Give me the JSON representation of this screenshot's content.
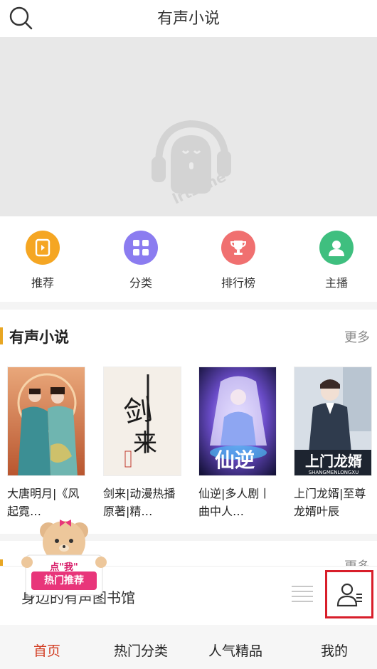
{
  "header": {
    "title": "有声小说",
    "search_icon": "search-icon"
  },
  "banner": {
    "logo_text": "lrts.me"
  },
  "quick_nav": [
    {
      "label": "推荐",
      "icon": "book-icon",
      "color": "#f5a623"
    },
    {
      "label": "分类",
      "icon": "grid-icon",
      "color": "#8b7cf0"
    },
    {
      "label": "排行榜",
      "icon": "trophy-icon",
      "color": "#f07070"
    },
    {
      "label": "主播",
      "icon": "anchor-icon",
      "color": "#3fbf7f"
    }
  ],
  "section": {
    "title": "有声小说",
    "more": "更多",
    "books": [
      {
        "title": "大唐明月|《风起霓…"
      },
      {
        "title": "剑来|动漫热播原著|精…"
      },
      {
        "title": "仙逆|多人剧丨曲中人…"
      },
      {
        "title": "上门龙婿|至尊龙婿叶辰"
      }
    ]
  },
  "section2": {
    "more": "更多"
  },
  "bottom_strip": {
    "text": "身边的有声图书馆"
  },
  "promo": {
    "line1": "点\"我\"",
    "line2": "热门推荐"
  },
  "covers": {
    "book2_char": "剑来",
    "book3_char": "仙逆",
    "book4_title": "上门龙婿",
    "book4_sub": "SHANGMENLONGXU"
  },
  "tabs": [
    {
      "label": "首页",
      "active": true
    },
    {
      "label": "热门分类",
      "active": false
    },
    {
      "label": "人气精品",
      "active": false
    },
    {
      "label": "我的",
      "active": false
    }
  ],
  "colors": {
    "accent": "#d13a1f",
    "section_bar": "#e8a623",
    "highlight_box": "#d81e2a"
  }
}
